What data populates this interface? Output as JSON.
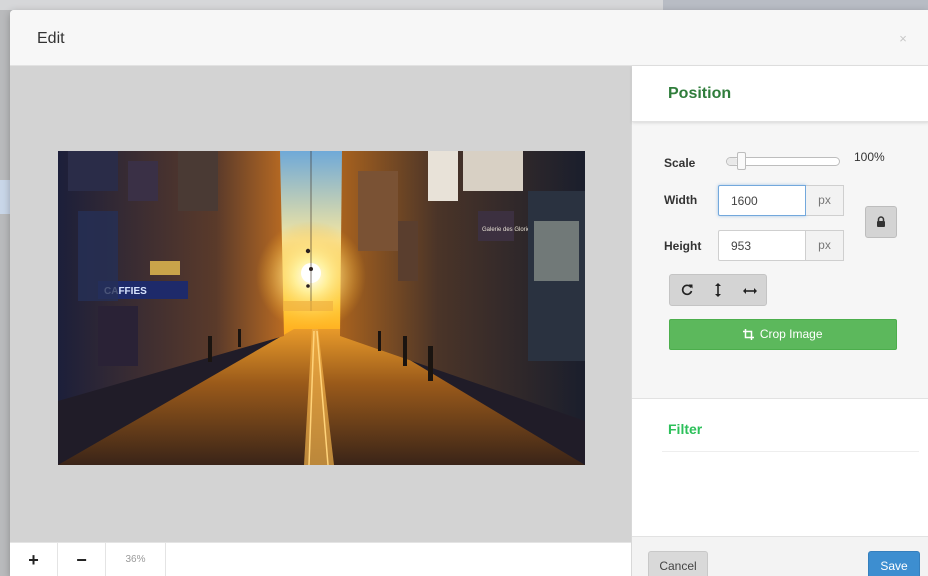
{
  "modal": {
    "title": "Edit",
    "close_glyph": "×"
  },
  "canvas": {
    "zoom_in_label": "+",
    "zoom_out_label": "−",
    "zoom_level": "36%",
    "image": {
      "subject": "sunset street photo",
      "sign_text": "CAFFIES",
      "shop_sign": "Galerie des Glories"
    }
  },
  "panel": {
    "position": {
      "heading": "Position",
      "scale_label": "Scale",
      "scale_value": "100%",
      "scale_fraction": 0.1,
      "width_label": "Width",
      "width_value": "1600",
      "height_label": "Height",
      "height_value": "953",
      "unit": "px",
      "lock_icon": "lock-icon",
      "tools": [
        "rotate-icon",
        "flip-vertical-icon",
        "flip-horizontal-icon"
      ],
      "crop_label": "Crop Image"
    },
    "filter": {
      "heading": "Filter"
    }
  },
  "footer": {
    "cancel_label": "Cancel",
    "save_label": "Save"
  },
  "colors": {
    "accent_green": "#5cb85c",
    "heading_green": "#2f7d3b",
    "save_blue": "#3d8ed0"
  }
}
